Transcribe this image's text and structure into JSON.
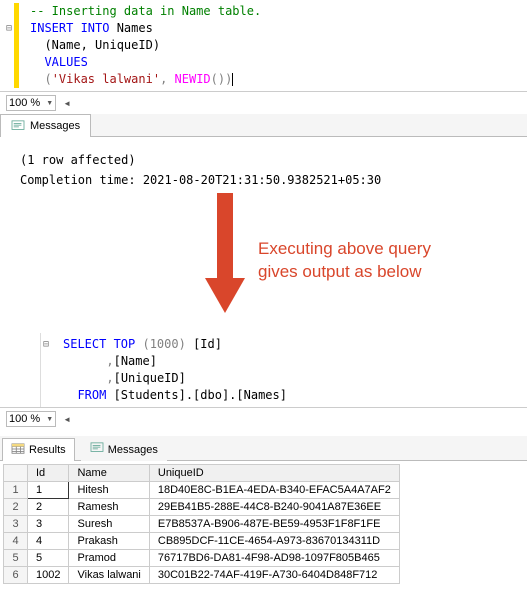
{
  "topEditor": {
    "comment": "-- Inserting data in Name table.",
    "insert": "INSERT INTO ",
    "tableName": "Names",
    "cols": "  (Name, UniqueID)",
    "values": "  VALUES",
    "valRow_open": "  (",
    "valRow_str": "'Vikas lalwani'",
    "valRow_sep": ", ",
    "valRow_fn": "NEWID",
    "valRow_close": "())"
  },
  "zoom": {
    "value": "100 %"
  },
  "tabs": {
    "messages": "Messages",
    "results": "Results"
  },
  "messages": {
    "line1": "(1 row affected)",
    "line2": "Completion time: 2021-08-20T21:31:50.9382521+05:30"
  },
  "annotation": {
    "line1": "Executing above query",
    "line2": "gives output as below"
  },
  "secondEditor": {
    "select": "SELECT TOP ",
    "topN": "(1000) ",
    "col1": "[Id]",
    "col2": ",[Name]",
    "col3": ",[UniqueID]",
    "from": "  FROM ",
    "db": "[Students].[dbo].[Names]",
    "indent": "      "
  },
  "grid": {
    "headers": [
      "",
      "Id",
      "Name",
      "UniqueID"
    ],
    "rows": [
      {
        "n": "1",
        "id": "1",
        "name": "Hitesh",
        "uid": "18D40E8C-B1EA-4EDA-B340-EFAC5A4A7AF2"
      },
      {
        "n": "2",
        "id": "2",
        "name": "Ramesh",
        "uid": "29EB41B5-288E-44C8-B240-9041A87E36EE"
      },
      {
        "n": "3",
        "id": "3",
        "name": "Suresh",
        "uid": "E7B8537A-B906-487E-BE59-4953F1F8F1FE"
      },
      {
        "n": "4",
        "id": "4",
        "name": "Prakash",
        "uid": "CB895DCF-11CE-4654-A973-83670134311D"
      },
      {
        "n": "5",
        "id": "5",
        "name": "Pramod",
        "uid": "76717BD6-DA81-4F98-AD98-1097F805B465"
      },
      {
        "n": "6",
        "id": "1002",
        "name": "Vikas lalwani",
        "uid": "30C01B22-74AF-419F-A730-6404D848F712"
      }
    ]
  }
}
